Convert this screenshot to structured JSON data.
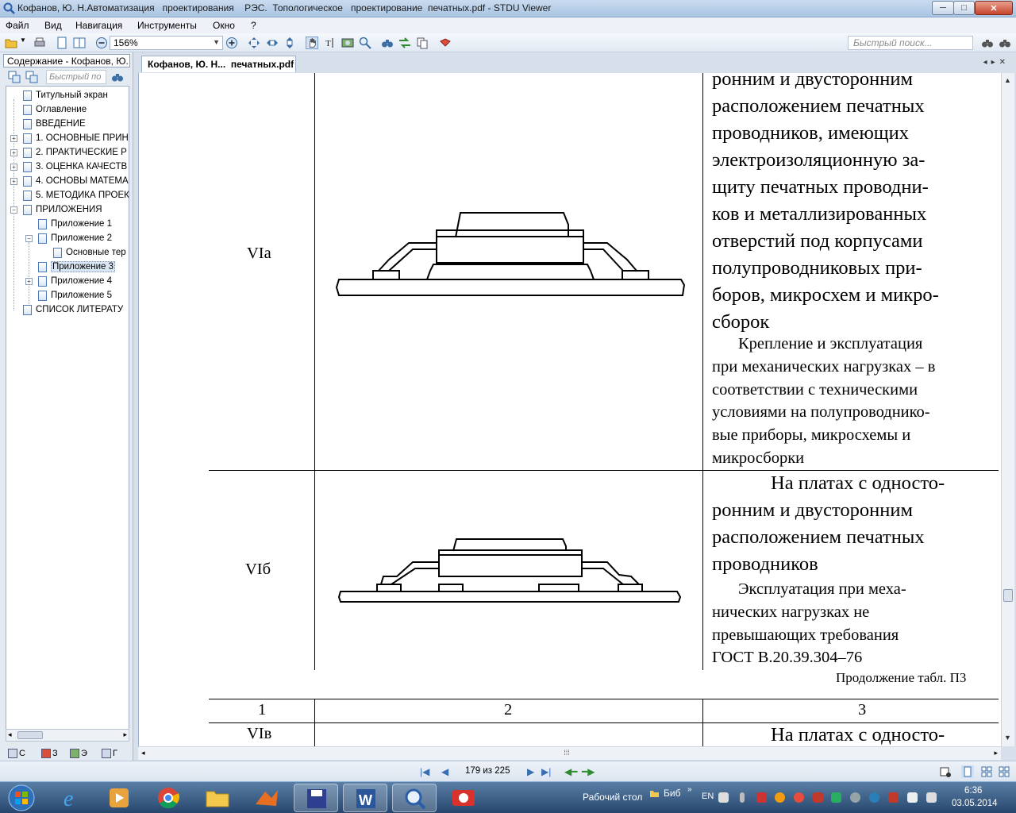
{
  "window": {
    "title": "Кофанов, Ю. Н.Автоматизация   проектирования    РЭС.  Топологическое   проектирование  печатных.pdf - STDU Viewer",
    "min_glyph": "─",
    "max_glyph": "□",
    "close_glyph": "✕"
  },
  "menu": [
    "Файл",
    "Вид",
    "Навигация",
    "Инструменты",
    "Окно",
    "?"
  ],
  "toolbar": {
    "zoom_value": "156%",
    "search_placeholder": "Быстрый поиск..."
  },
  "left_panel": {
    "header": "Содержание - Кофанов, Ю. Н",
    "search_placeholder": "Быстрый по",
    "tree": [
      "Титульный экран",
      "Оглавление",
      "ВВЕДЕНИЕ",
      "1. ОСНОВНЫЕ  ПРИН",
      "2. ПРАКТИЧЕСКИЕ Р",
      "3. ОЦЕНКА КАЧЕСТВ",
      "4. ОСНОВЫ  МАТЕМА",
      "5. МЕТОДИКА ПРОЕК",
      "ПРИЛОЖЕНИЯ",
      "Приложение 1",
      "Приложение 2",
      "Основные тер",
      "Приложение 3",
      "Приложение 4",
      "Приложение 5",
      "СПИСОК  ЛИТЕРАТУ"
    ],
    "tabs": [
      "С",
      "З",
      "Э",
      "Г"
    ]
  },
  "document": {
    "tab_title": "Кофанов, Ю. Н...  печатных.pdf",
    "rows": {
      "row_a": {
        "label": "VIа",
        "big_lines": [
          "ронним и двусторонним",
          "расположением печатных",
          "проводников, имеющих",
          "электроизоляционную за-",
          "щиту печатных проводни-",
          "ков и металлизированных",
          "отверстий под корпусами",
          "полупроводниковых при-",
          "боров, микросхем и микро-",
          "сборок"
        ],
        "small_lines": [
          "Крепление и эксплуатация",
          "при механических нагрузках – в",
          "соответствии с техническими",
          "условиями на полупроводнико-",
          "вые приборы, микросхемы и",
          "микросборки"
        ]
      },
      "row_b": {
        "label": "VIб",
        "big_lines": [
          "На платах с односто-",
          "ронним и двусторонним",
          "расположением печатных",
          "проводников"
        ],
        "small_lines": [
          "Эксплуатация  при  меха-",
          "нических    нагрузках    не",
          "превышающих требования",
          "ГОСТ В.20.39.304–76"
        ]
      },
      "continuation": "Продолжение табл. П3",
      "header_cols": [
        "1",
        "2",
        "3"
      ],
      "row_c": {
        "label": "VIв",
        "big_first": "На платах с односто-"
      }
    }
  },
  "status": {
    "page_indicator": "179 из 225"
  },
  "taskbar": {
    "desktop": "Рабочий стол",
    "bib": "Биб",
    "lang": "EN",
    "time": "6:36",
    "date": "03.05.2014"
  }
}
